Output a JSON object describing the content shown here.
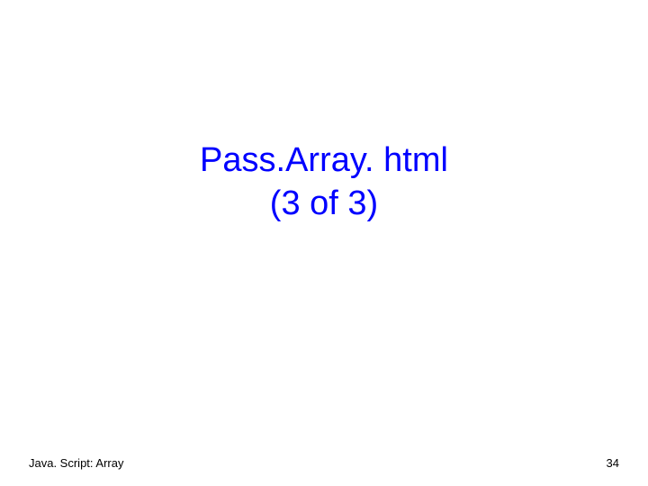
{
  "title": {
    "line1": "Pass.Array. html",
    "line2": "(3 of 3)"
  },
  "footer": {
    "left": "Java. Script: Array",
    "right": "34"
  }
}
